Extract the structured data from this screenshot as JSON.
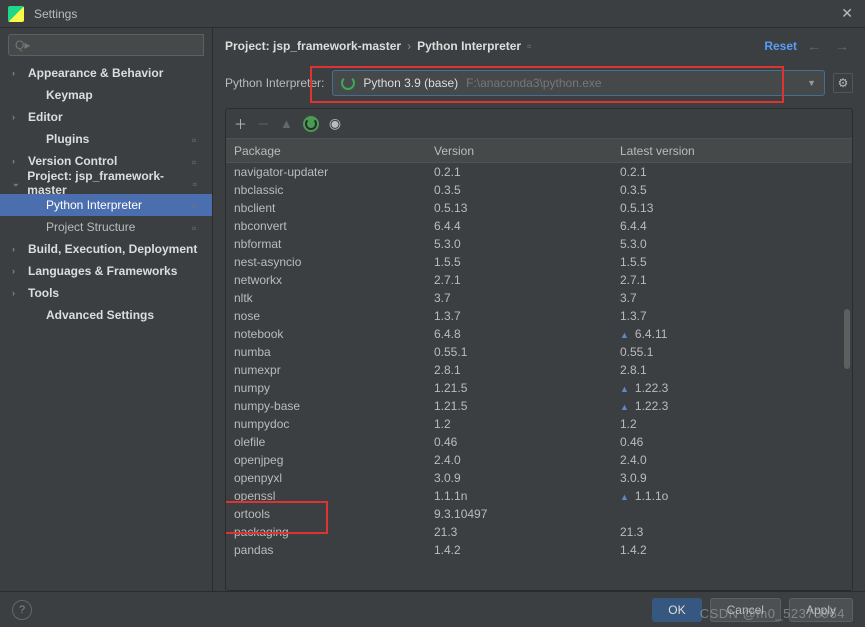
{
  "window": {
    "title": "Settings"
  },
  "search": {
    "placeholder": "Q▸"
  },
  "tree": [
    {
      "label": "Appearance & Behavior",
      "chev": "›",
      "bold": true
    },
    {
      "label": "Keymap",
      "bold": true,
      "lvl": 1,
      "noChev": true
    },
    {
      "label": "Editor",
      "chev": "›",
      "bold": true
    },
    {
      "label": "Plugins",
      "bold": true,
      "lvl": 1,
      "sq": true,
      "noChev": true
    },
    {
      "label": "Version Control",
      "chev": "›",
      "bold": true,
      "sq": true
    },
    {
      "label": "Project: jsp_framework-master",
      "chev": "⌄",
      "bold": true,
      "sq": true
    },
    {
      "label": "Python Interpreter",
      "lvl": 1,
      "sel": true,
      "sq": true
    },
    {
      "label": "Project Structure",
      "lvl": 1,
      "sq": true
    },
    {
      "label": "Build, Execution, Deployment",
      "chev": "›",
      "bold": true
    },
    {
      "label": "Languages & Frameworks",
      "chev": "›",
      "bold": true
    },
    {
      "label": "Tools",
      "chev": "›",
      "bold": true
    },
    {
      "label": "Advanced Settings",
      "bold": true,
      "lvl": 1,
      "noChev": true
    }
  ],
  "breadcrumb": {
    "a": "Project: jsp_framework-master",
    "b": "Python Interpreter",
    "reset": "Reset"
  },
  "picker": {
    "label": "Python Interpreter:",
    "name": "Python 3.9 (base)",
    "path": "F:\\anaconda3\\python.exe"
  },
  "table": {
    "headers": {
      "c1": "Package",
      "c2": "Version",
      "c3": "Latest version"
    }
  },
  "packages": [
    {
      "n": "navigator-updater",
      "v": "0.2.1",
      "l": "0.2.1"
    },
    {
      "n": "nbclassic",
      "v": "0.3.5",
      "l": "0.3.5"
    },
    {
      "n": "nbclient",
      "v": "0.5.13",
      "l": "0.5.13"
    },
    {
      "n": "nbconvert",
      "v": "6.4.4",
      "l": "6.4.4"
    },
    {
      "n": "nbformat",
      "v": "5.3.0",
      "l": "5.3.0"
    },
    {
      "n": "nest-asyncio",
      "v": "1.5.5",
      "l": "1.5.5"
    },
    {
      "n": "networkx",
      "v": "2.7.1",
      "l": "2.7.1"
    },
    {
      "n": "nltk",
      "v": "3.7",
      "l": "3.7"
    },
    {
      "n": "nose",
      "v": "1.3.7",
      "l": "1.3.7"
    },
    {
      "n": "notebook",
      "v": "6.4.8",
      "l": "6.4.11",
      "up": true
    },
    {
      "n": "numba",
      "v": "0.55.1",
      "l": "0.55.1"
    },
    {
      "n": "numexpr",
      "v": "2.8.1",
      "l": "2.8.1"
    },
    {
      "n": "numpy",
      "v": "1.21.5",
      "l": "1.22.3",
      "up": true
    },
    {
      "n": "numpy-base",
      "v": "1.21.5",
      "l": "1.22.3",
      "up": true
    },
    {
      "n": "numpydoc",
      "v": "1.2",
      "l": "1.2"
    },
    {
      "n": "olefile",
      "v": "0.46",
      "l": "0.46"
    },
    {
      "n": "openjpeg",
      "v": "2.4.0",
      "l": "2.4.0"
    },
    {
      "n": "openpyxl",
      "v": "3.0.9",
      "l": "3.0.9"
    },
    {
      "n": "openssl",
      "v": "1.1.1n",
      "l": "1.1.1o",
      "up": true
    },
    {
      "n": "ortools",
      "v": "9.3.10497",
      "l": ""
    },
    {
      "n": "packaging",
      "v": "21.3",
      "l": "21.3"
    },
    {
      "n": "pandas",
      "v": "1.4.2",
      "l": "1.4.2"
    }
  ],
  "footer": {
    "ok": "OK",
    "cancel": "Cancel",
    "apply": "Apply"
  },
  "watermark": "CSDN @m0_52370964"
}
